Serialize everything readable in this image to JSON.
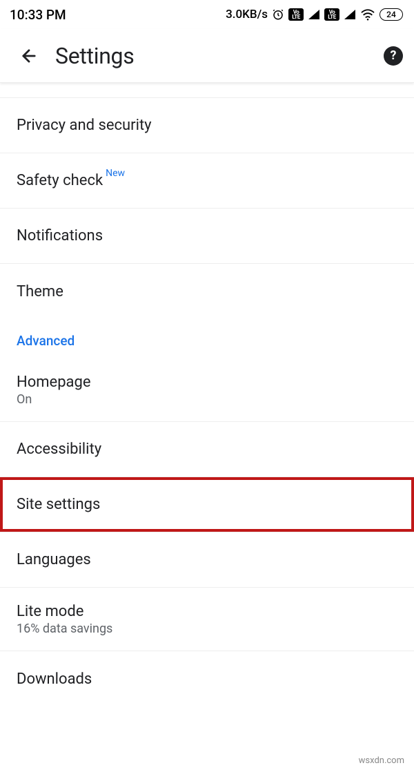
{
  "statusbar": {
    "time": "10:33 PM",
    "speed": "3.0KB/s",
    "battery": "24"
  },
  "header": {
    "title": "Settings"
  },
  "items": {
    "privacy": {
      "label": "Privacy and security"
    },
    "safety": {
      "label": "Safety check",
      "badge": "New"
    },
    "notifications": {
      "label": "Notifications"
    },
    "theme": {
      "label": "Theme"
    }
  },
  "section": {
    "advanced": "Advanced"
  },
  "advanced": {
    "homepage": {
      "label": "Homepage",
      "sub": "On"
    },
    "accessibility": {
      "label": "Accessibility"
    },
    "site": {
      "label": "Site settings"
    },
    "languages": {
      "label": "Languages"
    },
    "lite": {
      "label": "Lite mode",
      "sub": "16% data savings"
    },
    "downloads": {
      "label": "Downloads"
    }
  },
  "watermark": "wsxdn.com"
}
